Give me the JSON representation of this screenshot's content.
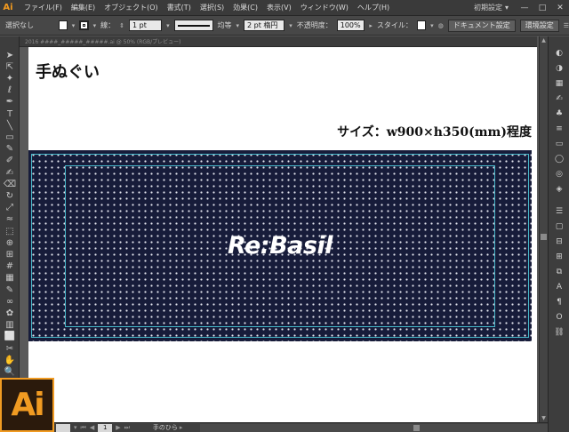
{
  "app": {
    "logo_small": "Ai",
    "logo_large": "Ai",
    "accent_color": "#f19b22"
  },
  "menu": {
    "items": [
      "ファイル(F)",
      "編集(E)",
      "オブジェクト(O)",
      "書式(T)",
      "選択(S)",
      "効果(C)",
      "表示(V)",
      "ウィンドウ(W)",
      "ヘルプ(H)"
    ],
    "workspace": "初期設定",
    "window_controls": [
      "—",
      "□",
      "✕"
    ]
  },
  "controlbar": {
    "selection": "選択なし",
    "stroke_label": "線：",
    "stroke_weight": "1 pt",
    "profile": "均等",
    "brush": "2 pt 楕円",
    "opacity_label": "不透明度：",
    "opacity_value": "100%",
    "style_label": "スタイル：",
    "doc_settings_button": "ドキュメント設定",
    "preferences_button": "環境設定"
  },
  "document": {
    "tab_title": "2016 ####_#####_#####.ai @ 50% (RGB/プレビュー)",
    "heading": "手ぬぐい",
    "size_label": "サイズ：w900×h350(mm)程度",
    "brand_text": "Re:Basil",
    "towel_color": "#171c3a",
    "guide_color": "#46b6c8"
  },
  "toolbar": {
    "tools": [
      "selection-tool",
      "direct-selection-tool",
      "magic-wand-tool",
      "lasso-tool",
      "pen-tool",
      "type-tool",
      "line-tool",
      "rectangle-tool",
      "paintbrush-tool",
      "pencil-tool",
      "blob-brush-tool",
      "eraser-tool",
      "rotate-tool",
      "scale-tool",
      "width-tool",
      "free-transform-tool",
      "shape-builder-tool",
      "perspective-grid-tool",
      "mesh-tool",
      "gradient-tool",
      "eyedropper-tool",
      "blend-tool",
      "symbol-sprayer-tool",
      "column-graph-tool",
      "artboard-tool",
      "slice-tool",
      "hand-tool",
      "zoom-tool"
    ],
    "tool_glyphs": [
      "➤",
      "⇱",
      "✦",
      "ℓ",
      "✒",
      "T",
      "╲",
      "▭",
      "✎",
      "✐",
      "✍",
      "⌫",
      "↻",
      "⤢",
      "≈",
      "⬚",
      "⊕",
      "⊞",
      "#",
      "▦",
      "✎",
      "∞",
      "✿",
      "▥",
      "⬜",
      "✂",
      "✋",
      "🔍"
    ]
  },
  "rightpanel": {
    "icons": [
      "color-icon",
      "color-guide-icon",
      "swatches-icon",
      "brushes-icon",
      "symbols-icon",
      "stroke-icon",
      "gradient-icon",
      "transparency-icon",
      "appearance-icon",
      "graphic-styles-icon",
      "layers-icon",
      "artboards-icon",
      "align-icon",
      "transform-icon",
      "pathfinder-icon",
      "character-icon",
      "paragraph-icon",
      "opentype-icon",
      "links-icon"
    ],
    "glyphs": [
      "◐",
      "◑",
      "▦",
      "✍",
      "♣",
      "≡",
      "▭",
      "◯",
      "◎",
      "◈",
      "☰",
      "▢",
      "⊟",
      "⊞",
      "⧉",
      "A",
      "¶",
      "O",
      "⛓"
    ]
  },
  "statusbar": {
    "zoom": "",
    "page": "1",
    "status_text": "手のひら"
  }
}
